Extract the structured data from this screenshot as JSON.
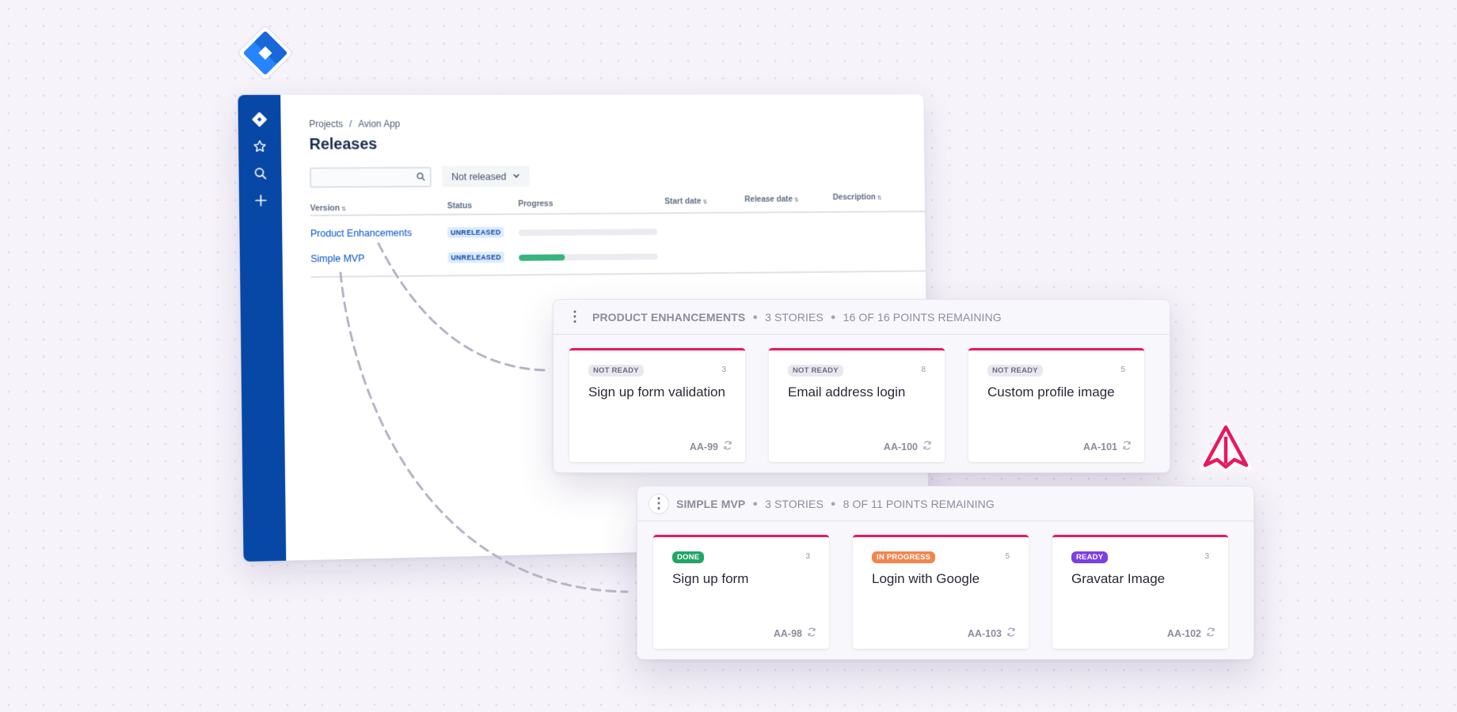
{
  "jira": {
    "sidebar_icons": [
      "jira-logo-icon",
      "star-icon",
      "search-icon",
      "plus-icon"
    ],
    "breadcrumb": {
      "root": "Projects",
      "separator": "/",
      "current": "Avion App"
    },
    "title": "Releases",
    "search": {
      "value": ""
    },
    "status_filter": "Not released",
    "columns": [
      "Version",
      "Status",
      "Progress",
      "Start date",
      "Release date",
      "Description"
    ],
    "releases": [
      {
        "version": "Product Enhancements",
        "status": "UNRELEASED",
        "progress": 0
      },
      {
        "version": "Simple MVP",
        "status": "UNRELEASED",
        "progress": 0.33
      }
    ]
  },
  "avion": {
    "panels": [
      {
        "name": "PRODUCT ENHANCEMENTS",
        "stories": "3 STORIES",
        "points": "16 OF 16 POINTS REMAINING",
        "cards": [
          {
            "tag": "NOT READY",
            "points": "3",
            "title": "Sign up form validation",
            "key": "AA-99"
          },
          {
            "tag": "NOT READY",
            "points": "8",
            "title": "Email address login",
            "key": "AA-100"
          },
          {
            "tag": "NOT READY",
            "points": "5",
            "title": "Custom profile image",
            "key": "AA-101"
          }
        ]
      },
      {
        "name": "SIMPLE MVP",
        "stories": "3 STORIES",
        "points": "8 OF 11 POINTS REMAINING",
        "cards": [
          {
            "tag": "DONE",
            "points": "3",
            "title": "Sign up form",
            "key": "AA-98"
          },
          {
            "tag": "IN PROGRESS",
            "points": "5",
            "title": "Login with Google",
            "key": "AA-103"
          },
          {
            "tag": "READY",
            "points": "3",
            "title": "Gravatar Image",
            "key": "AA-102"
          }
        ]
      }
    ]
  },
  "colors": {
    "jira_blue": "#0747a6",
    "link_blue": "#0052cc",
    "progress_green": "#36b37e",
    "avion_pink": "#e8185f",
    "done_green": "#22a565",
    "in_progress_orange": "#f2854e",
    "ready_purple": "#7b3fe4"
  }
}
